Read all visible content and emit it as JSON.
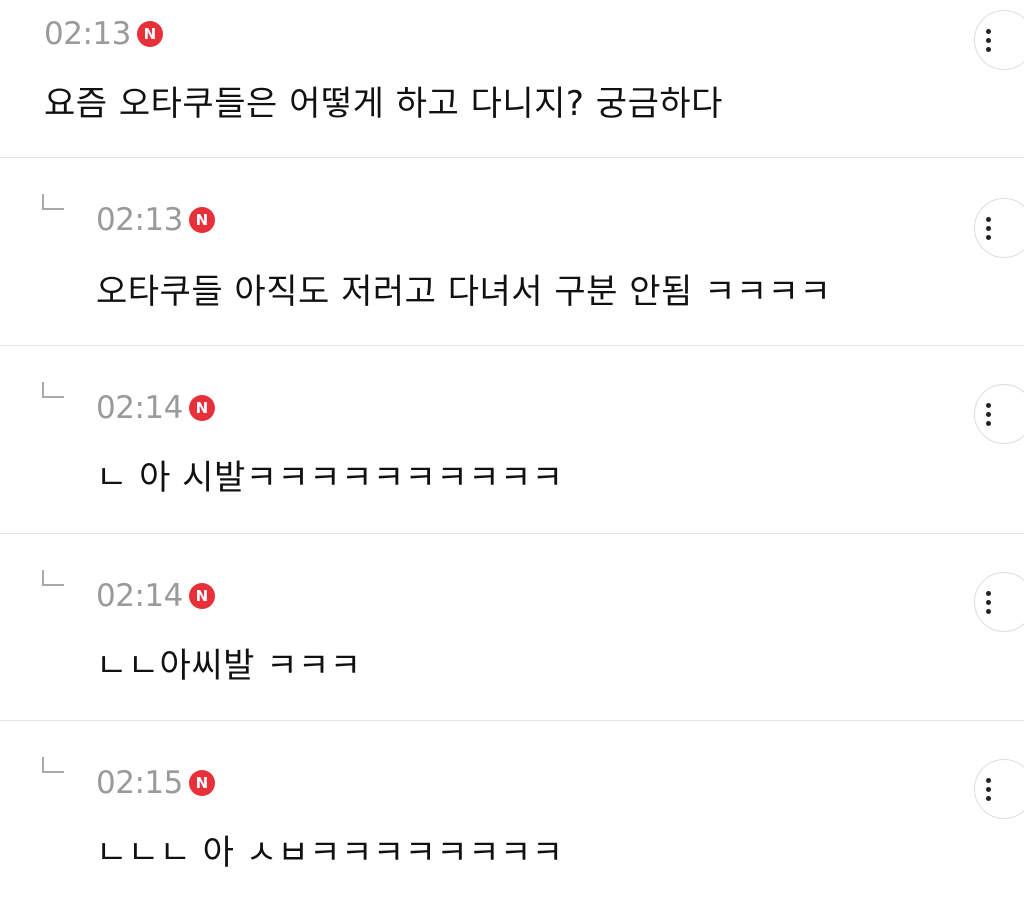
{
  "comments": [
    {
      "time": "02:13",
      "badge": "N",
      "text": "요즘 오타쿠들은 어떻게 하고 다니지? 궁금하다",
      "is_reply": false
    },
    {
      "time": "02:13",
      "badge": "N",
      "text": "오타쿠들 아직도 저러고 다녀서 구분 안됨 ㅋㅋㅋㅋ",
      "is_reply": true
    },
    {
      "time": "02:14",
      "badge": "N",
      "text": "ㄴ 아 시발ㅋㅋㅋㅋㅋㅋㅋㅋㅋㅋ",
      "is_reply": true
    },
    {
      "time": "02:14",
      "badge": "N",
      "text": "ㄴㄴ아씨발 ㅋㅋㅋ",
      "is_reply": true
    },
    {
      "time": "02:15",
      "badge": "N",
      "text": "ㄴㄴㄴ 아 ㅅㅂㅋㅋㅋㅋㅋㅋㅋㅋ",
      "is_reply": true
    }
  ],
  "icons": {
    "reply": "reply-arrow-icon",
    "new": "new-badge",
    "more": "kebab-menu-icon"
  },
  "colors": {
    "badge": "#e8303a",
    "time": "#9a9a9a",
    "divider": "#e3e3e3"
  }
}
